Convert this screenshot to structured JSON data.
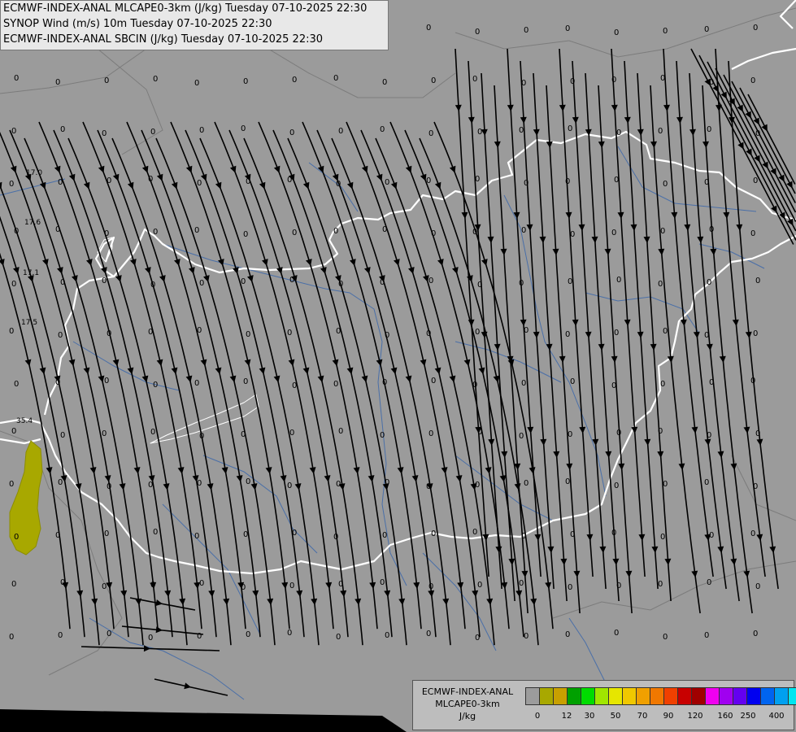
{
  "header": {
    "line1": "ECMWF-INDEX-ANAL MLCAPE0-3km (J/kg) Tuesday 07-10-2025 22:30",
    "line2": "SYNOP Wind (m/s) 10m Tuesday 07-10-2025 22:30",
    "line3": "ECMWF-INDEX-ANAL SBCIN (J/kg) Tuesday 07-10-2025 22:30"
  },
  "legend": {
    "title_line1": "ECMWF-INDEX-ANAL",
    "title_line2": "MLCAPE0-3km",
    "unit": "J/kg",
    "colors": [
      "#9c9c9c",
      "#a8a800",
      "#c8a000",
      "#00a000",
      "#00dc00",
      "#a0e600",
      "#e6e600",
      "#f0c800",
      "#f0a000",
      "#f07800",
      "#f04000",
      "#c80000",
      "#a00000",
      "#f000f0",
      "#a000f0",
      "#6400f0",
      "#0000f0",
      "#0064f0",
      "#00a0f0",
      "#00e6f0",
      "#a0f0f0",
      "#ffffff"
    ],
    "tick_labels": [
      "0",
      "12",
      "30",
      "50",
      "70",
      "90",
      "120",
      "160",
      "250",
      "400"
    ]
  },
  "map": {
    "background": "#9b9b9b",
    "border_color": "#ffffff",
    "river_color": "#4a6fa8",
    "zero_label": "0",
    "cin_labels": [
      "17.0",
      "17.6",
      "17.1",
      "17.5",
      "35.4"
    ],
    "cape_patch_color": "#a8a800"
  }
}
